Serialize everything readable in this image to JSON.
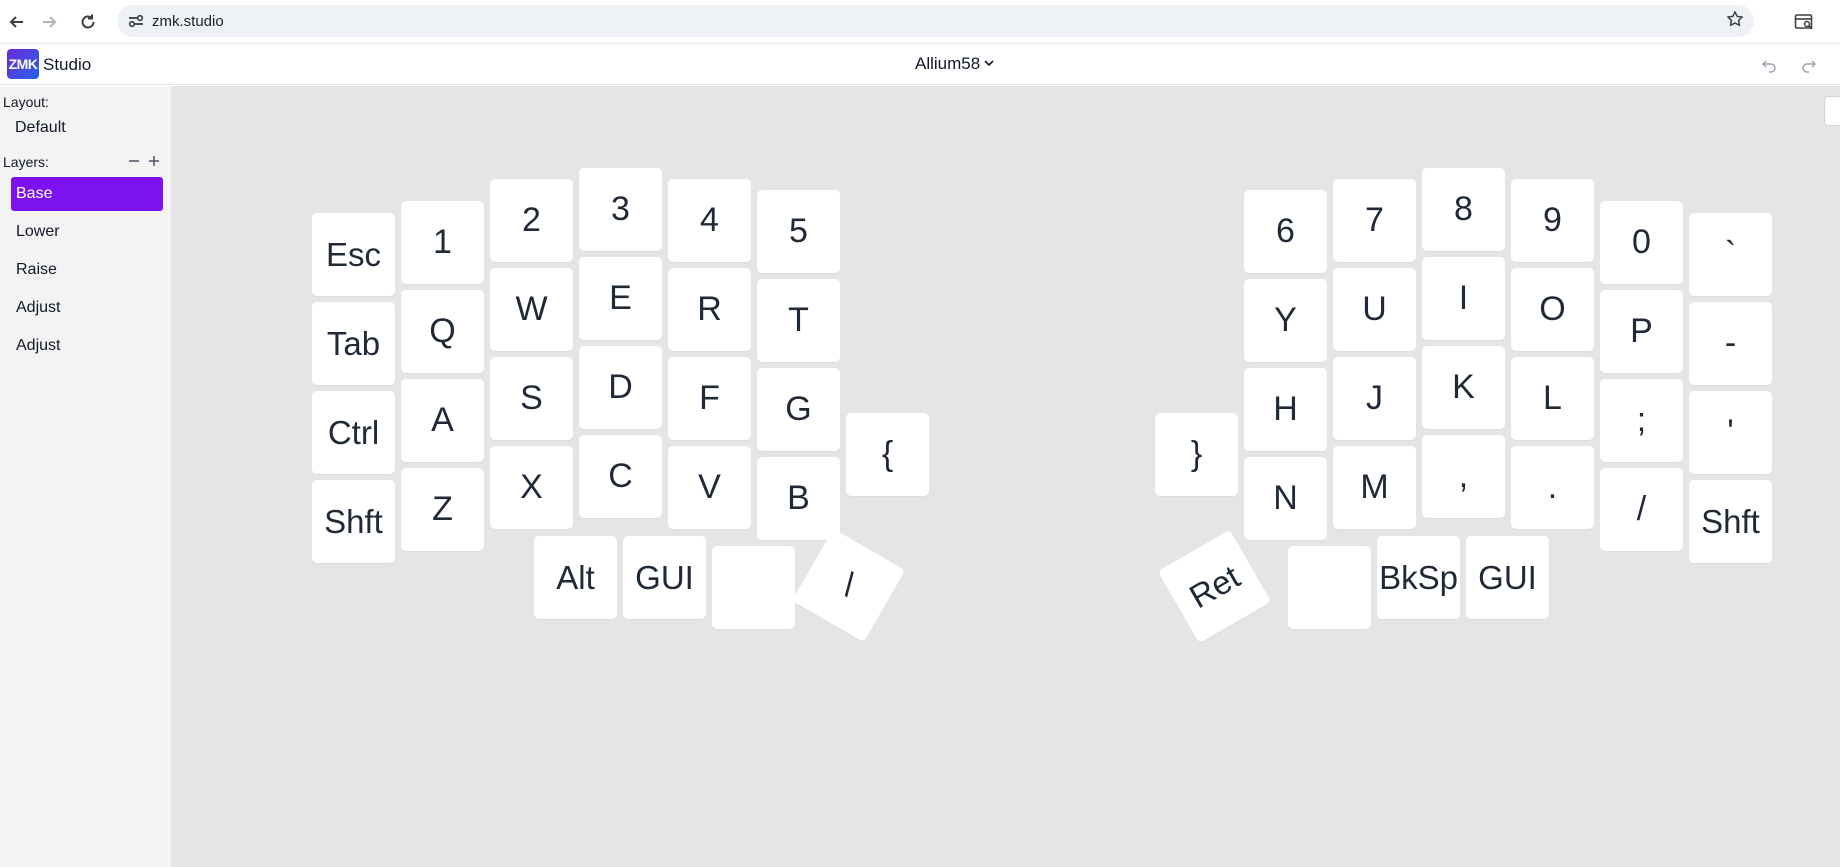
{
  "browser": {
    "url": "zmk.studio",
    "icons": {
      "back": "arrow-left-icon",
      "forward": "arrow-right-icon",
      "reload": "reload-icon",
      "site": "site-settings-icon",
      "bookmark": "star-icon",
      "extension": "tab-search-icon"
    }
  },
  "app": {
    "logo_text": "ZMK",
    "name": "Studio",
    "keyboard_name": "Allium58",
    "icons": {
      "dropdown": "chevron-down-icon",
      "undo": "undo-icon",
      "redo": "redo-icon"
    }
  },
  "sidebar": {
    "layout_label": "Layout:",
    "layout_value": "Default",
    "layers_label": "Layers:",
    "layers": [
      "Base",
      "Lower",
      "Raise",
      "Adjust",
      "Adjust"
    ],
    "selected_layer": 0
  },
  "keyboard": {
    "left": {
      "row0": [
        "Esc",
        "1",
        "2",
        "3",
        "4",
        "5"
      ],
      "row1": [
        "Tab",
        "Q",
        "W",
        "E",
        "R",
        "T"
      ],
      "row2": [
        "Ctrl",
        "A",
        "S",
        "D",
        "F",
        "G"
      ],
      "row3": [
        "Shft",
        "Z",
        "X",
        "C",
        "V",
        "B"
      ],
      "inner": "{",
      "thumbs": [
        "Alt",
        "GUI",
        "",
        "\\"
      ]
    },
    "right": {
      "row0": [
        "6",
        "7",
        "8",
        "9",
        "0",
        "`"
      ],
      "row1": [
        "Y",
        "U",
        "I",
        "O",
        "P",
        "-"
      ],
      "row2": [
        "H",
        "J",
        "K",
        "L",
        ";",
        "'"
      ],
      "row3": [
        "N",
        "M",
        ",",
        ".",
        "/",
        "Shft"
      ],
      "inner": "}",
      "thumbs": [
        "Ret",
        "",
        "BkSp",
        "GUI"
      ]
    }
  }
}
